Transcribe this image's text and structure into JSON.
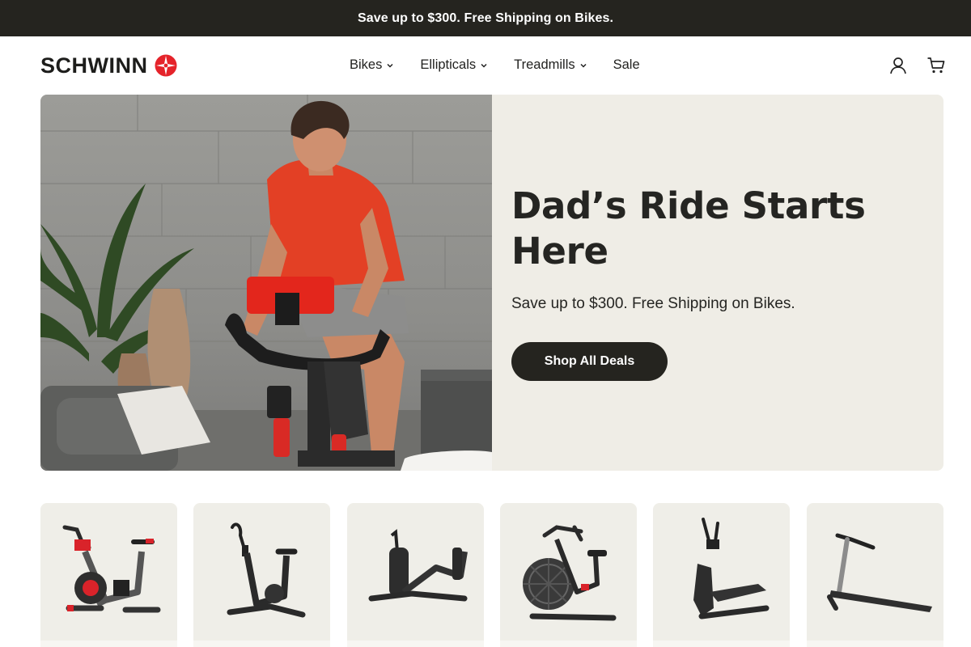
{
  "promo": {
    "text": "Save up to $300. Free Shipping on Bikes."
  },
  "brand": {
    "name": "SCHWINN",
    "accent": "#e5232a"
  },
  "nav": {
    "items": [
      {
        "label": "Bikes",
        "has_dropdown": true
      },
      {
        "label": "Ellipticals",
        "has_dropdown": true
      },
      {
        "label": "Treadmills",
        "has_dropdown": true
      },
      {
        "label": "Sale",
        "has_dropdown": false
      }
    ]
  },
  "header_icons": {
    "account": "user-icon",
    "cart": "cart-icon"
  },
  "hero": {
    "title": "Dad’s Ride Starts Here",
    "subtitle": "Save up to $300. Free Shipping on Bikes.",
    "cta_label": "Shop All Deals",
    "image": "man-riding-indoor-bike-photo"
  },
  "products": [
    {
      "icon": "indoor-cycling-bike-icon"
    },
    {
      "icon": "upright-bike-icon"
    },
    {
      "icon": "recumbent-bike-icon"
    },
    {
      "icon": "airdyne-bike-icon"
    },
    {
      "icon": "elliptical-icon"
    },
    {
      "icon": "treadmill-icon"
    }
  ],
  "colors": {
    "dark": "#25241f",
    "hero_bg": "#efede6",
    "tile_bg": "#efeee8"
  }
}
